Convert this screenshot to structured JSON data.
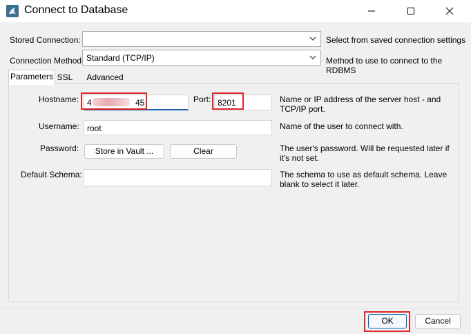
{
  "window": {
    "title": "Connect to Database"
  },
  "stored_connection": {
    "label": "Stored Connection:",
    "value": "",
    "hint": "Select from saved connection settings"
  },
  "connection_method": {
    "label": "Connection Method:",
    "value": "Standard (TCP/IP)",
    "hint": "Method to use to connect to the RDBMS"
  },
  "tabs": [
    {
      "label": "Parameters",
      "active": true
    },
    {
      "label": "SSL",
      "active": false
    },
    {
      "label": "Advanced",
      "active": false
    }
  ],
  "params": {
    "hostname": {
      "label": "Hostname:",
      "value_prefix": "4",
      "value_suffix": "45",
      "hint": "Name or IP address of the server host - and TCP/IP port."
    },
    "port": {
      "label": "Port:",
      "value": "8201"
    },
    "username": {
      "label": "Username:",
      "value": "root",
      "hint": "Name of the user to connect with."
    },
    "password": {
      "label": "Password:",
      "store_button": "Store in Vault ...",
      "clear_button": "Clear",
      "hint": "The user's password. Will be requested later if it's not set."
    },
    "default_schema": {
      "label": "Default Schema:",
      "value": "",
      "hint": "The schema to use as default schema. Leave blank to select it later."
    }
  },
  "footer": {
    "ok": "OK",
    "cancel": "Cancel"
  },
  "colors": {
    "highlight": "#e0262a",
    "focus": "#1a5fb4",
    "primary_border": "#0067c0"
  },
  "icons": {
    "app": "mysql-dolphin-icon",
    "minimize": "minimize-icon",
    "maximize": "maximize-icon",
    "close": "close-icon"
  }
}
